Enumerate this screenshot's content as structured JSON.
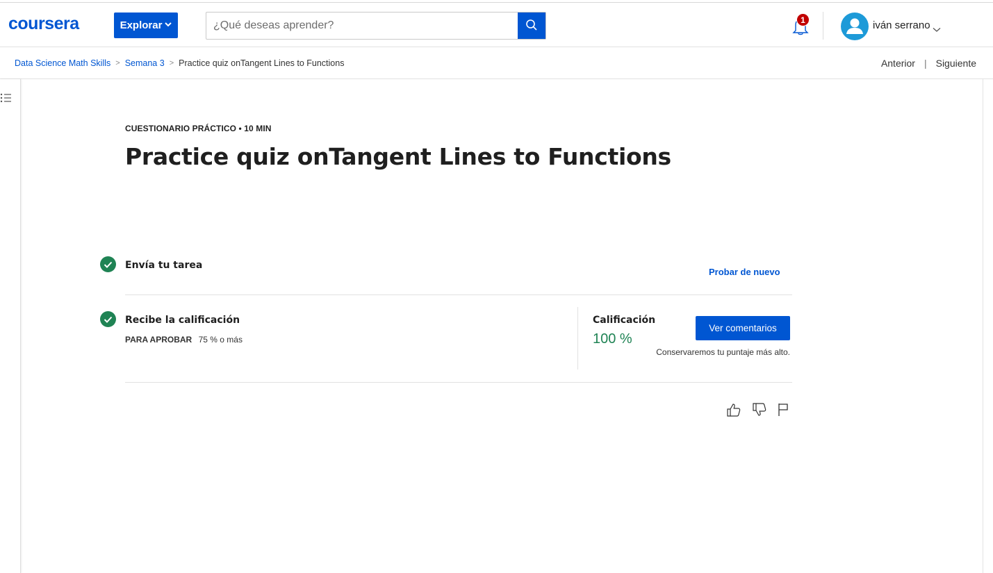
{
  "header": {
    "logo": "coursera",
    "explore_label": "Explorar",
    "search_placeholder": "¿Qué deseas aprender?",
    "notification_count": "1",
    "username": "iván serrano"
  },
  "breadcrumb": {
    "items": [
      "Data Science Math Skills",
      "Semana 3",
      "Practice quiz onTangent Lines to Functions"
    ],
    "prev_label": "Anterior",
    "next_label": "Siguiente"
  },
  "quiz": {
    "kicker": "CUESTIONARIO PRÁCTICO • 10 MIN",
    "title": "Practice quiz onTangent Lines to Functions",
    "step1_title": "Envía tu tarea",
    "retry_label": "Probar de nuevo",
    "step2_title": "Recibe la calificación",
    "pass_label": "PARA APROBAR",
    "pass_value": "75 % o más",
    "grade_label": "Calificación",
    "grade_value": "100 %",
    "feedback_label": "Ver comentarios",
    "keep_note": "Conservaremos tu puntaje más alto."
  },
  "colors": {
    "brand": "#0056d2",
    "success": "#1f8354",
    "badge": "#c10000"
  },
  "icons": [
    "search-icon",
    "bell-icon",
    "avatar-icon",
    "chevron-down-icon",
    "menu-list-icon",
    "check-icon",
    "thumbs-up-icon",
    "thumbs-down-icon",
    "flag-icon"
  ]
}
